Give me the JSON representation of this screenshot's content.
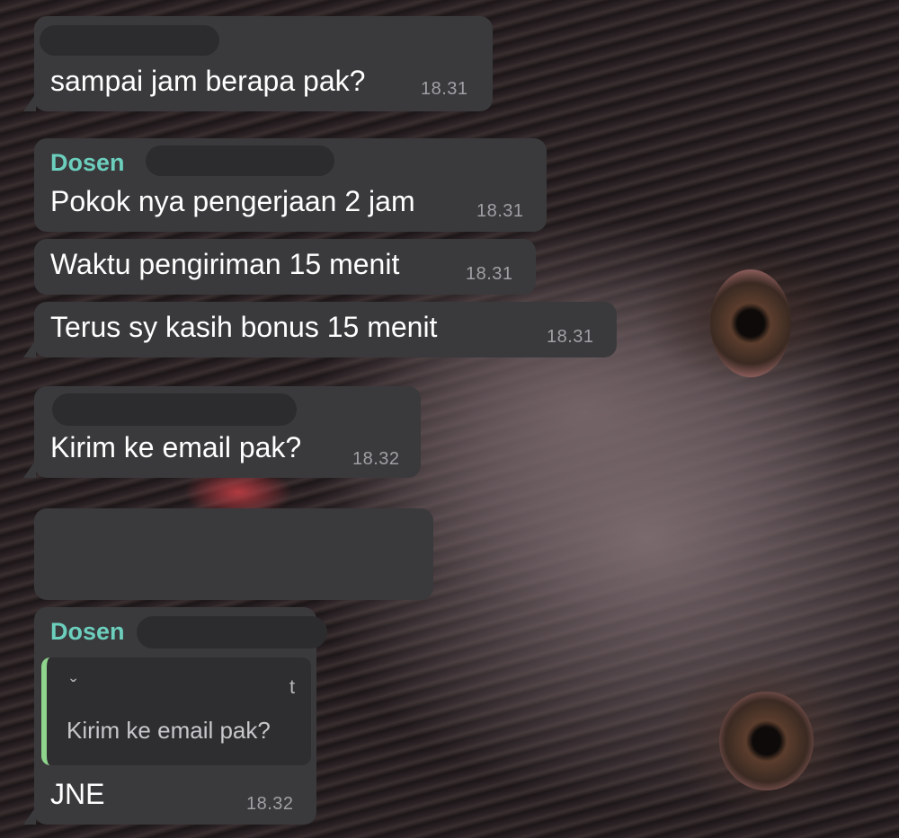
{
  "messages": [
    {
      "text": "sampai jam berapa pak?",
      "time": "18.31"
    },
    {
      "sender": "Dosen",
      "text": "Pokok nya pengerjaan 2 jam",
      "time": "18.31"
    },
    {
      "text": "Waktu pengiriman 15 menit",
      "time": "18.31"
    },
    {
      "text": "Terus sy kasih bonus 15 menit",
      "time": "18.31"
    },
    {
      "text": "Kirim ke email pak?",
      "time": "18.32"
    },
    {
      "sender": "Dosen",
      "quote": "Kirim ke email pak?",
      "text": "JNE",
      "time": "18.32"
    }
  ],
  "colors": {
    "bubble": "#3a3a3c",
    "sender_name": "#6ccfbd",
    "quote_bar": "#8fd48c",
    "timestamp": "#a0a0a5"
  }
}
